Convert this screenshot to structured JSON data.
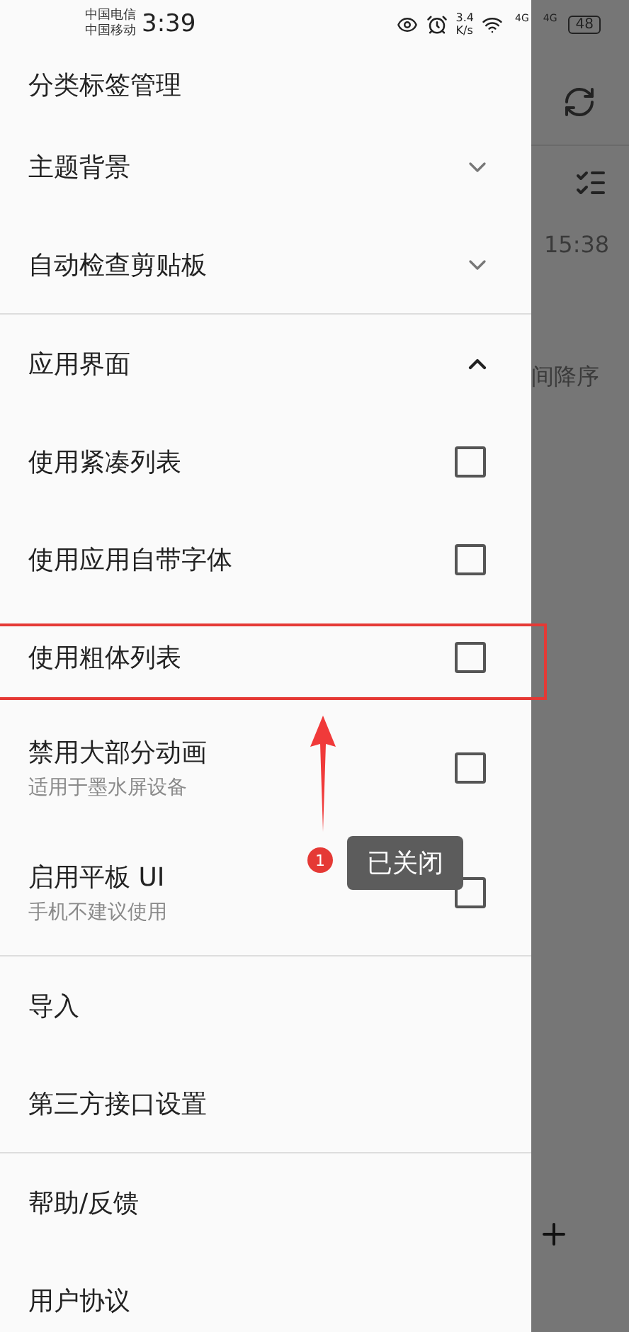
{
  "status_bar": {
    "carriers": [
      "中国电信",
      "中国移动"
    ],
    "time": "3:39",
    "net_speed": [
      "3.4",
      "K/s"
    ],
    "signals": [
      "4G",
      "4G"
    ],
    "battery": "48"
  },
  "drawer": {
    "sections": [
      [
        {
          "kind": "link",
          "label": "分类标签管理"
        },
        {
          "kind": "expand",
          "label": "主题背景",
          "expanded": false
        },
        {
          "kind": "expand",
          "label": "自动检查剪贴板",
          "expanded": false
        }
      ],
      [
        {
          "kind": "expand",
          "label": "应用界面",
          "expanded": true
        },
        {
          "kind": "checkbox",
          "label": "使用紧凑列表",
          "checked": false,
          "highlighted": false
        },
        {
          "kind": "checkbox",
          "label": "使用应用自带字体",
          "checked": false,
          "highlighted": false
        },
        {
          "kind": "checkbox",
          "label": "使用粗体列表",
          "checked": false,
          "highlighted": true
        },
        {
          "kind": "checkbox",
          "label": "禁用大部分动画",
          "subtitle": "适用于墨水屏设备",
          "checked": false,
          "highlighted": false
        },
        {
          "kind": "checkbox",
          "label": "启用平板 UI",
          "subtitle": "手机不建议使用",
          "checked": false,
          "highlighted": false
        }
      ],
      [
        {
          "kind": "link",
          "label": "导入"
        },
        {
          "kind": "link",
          "label": "第三方接口设置"
        }
      ],
      [
        {
          "kind": "link",
          "label": "帮助/反馈"
        },
        {
          "kind": "link",
          "label": "用户协议"
        }
      ]
    ]
  },
  "background": {
    "time_text": "15:38",
    "sort_text": "间降序"
  },
  "annotation": {
    "badge": "1",
    "label": "已关闭"
  }
}
